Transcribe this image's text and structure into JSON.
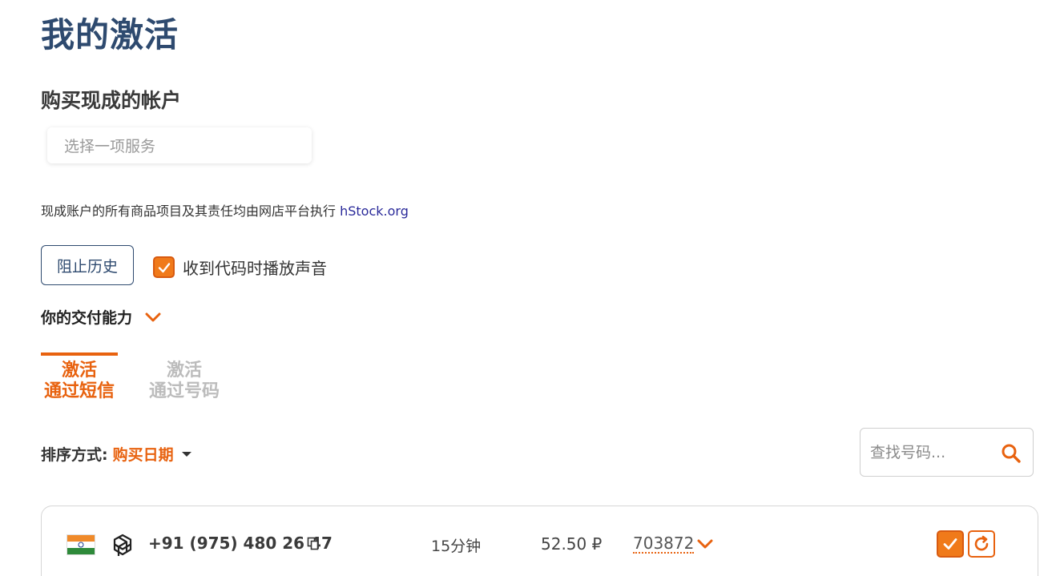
{
  "header": {
    "title": "我的激活"
  },
  "ready_accounts": {
    "title": "购买现成的帐户",
    "service_placeholder": "选择一项服务",
    "notice_text": "现成账户的所有商品项目及其责任均由网店平台执行 ",
    "notice_link": "hStock.org"
  },
  "controls": {
    "block_history_label": "阻止历史",
    "sound_label": "收到代码时播放声音",
    "sound_checked": true,
    "capability_label": "你的交付能力"
  },
  "tabs": [
    {
      "line1": "激活",
      "line2": "通过短信",
      "active": true
    },
    {
      "line1": "激活",
      "line2": "通过号码",
      "active": false
    }
  ],
  "sort": {
    "label": "排序方式:",
    "value": "购买日期"
  },
  "search": {
    "placeholder": "查找号码..."
  },
  "activations": [
    {
      "country_flag": "india-flag",
      "service_icon": "openai-icon",
      "phone": "+91 (975) 480 26 47",
      "duration": "15分钟",
      "price": "52.50 ₽",
      "code": "703872"
    }
  ],
  "colors": {
    "accent": "#e8620f",
    "title": "#2e4a6f",
    "muted": "#bcbcbc"
  }
}
